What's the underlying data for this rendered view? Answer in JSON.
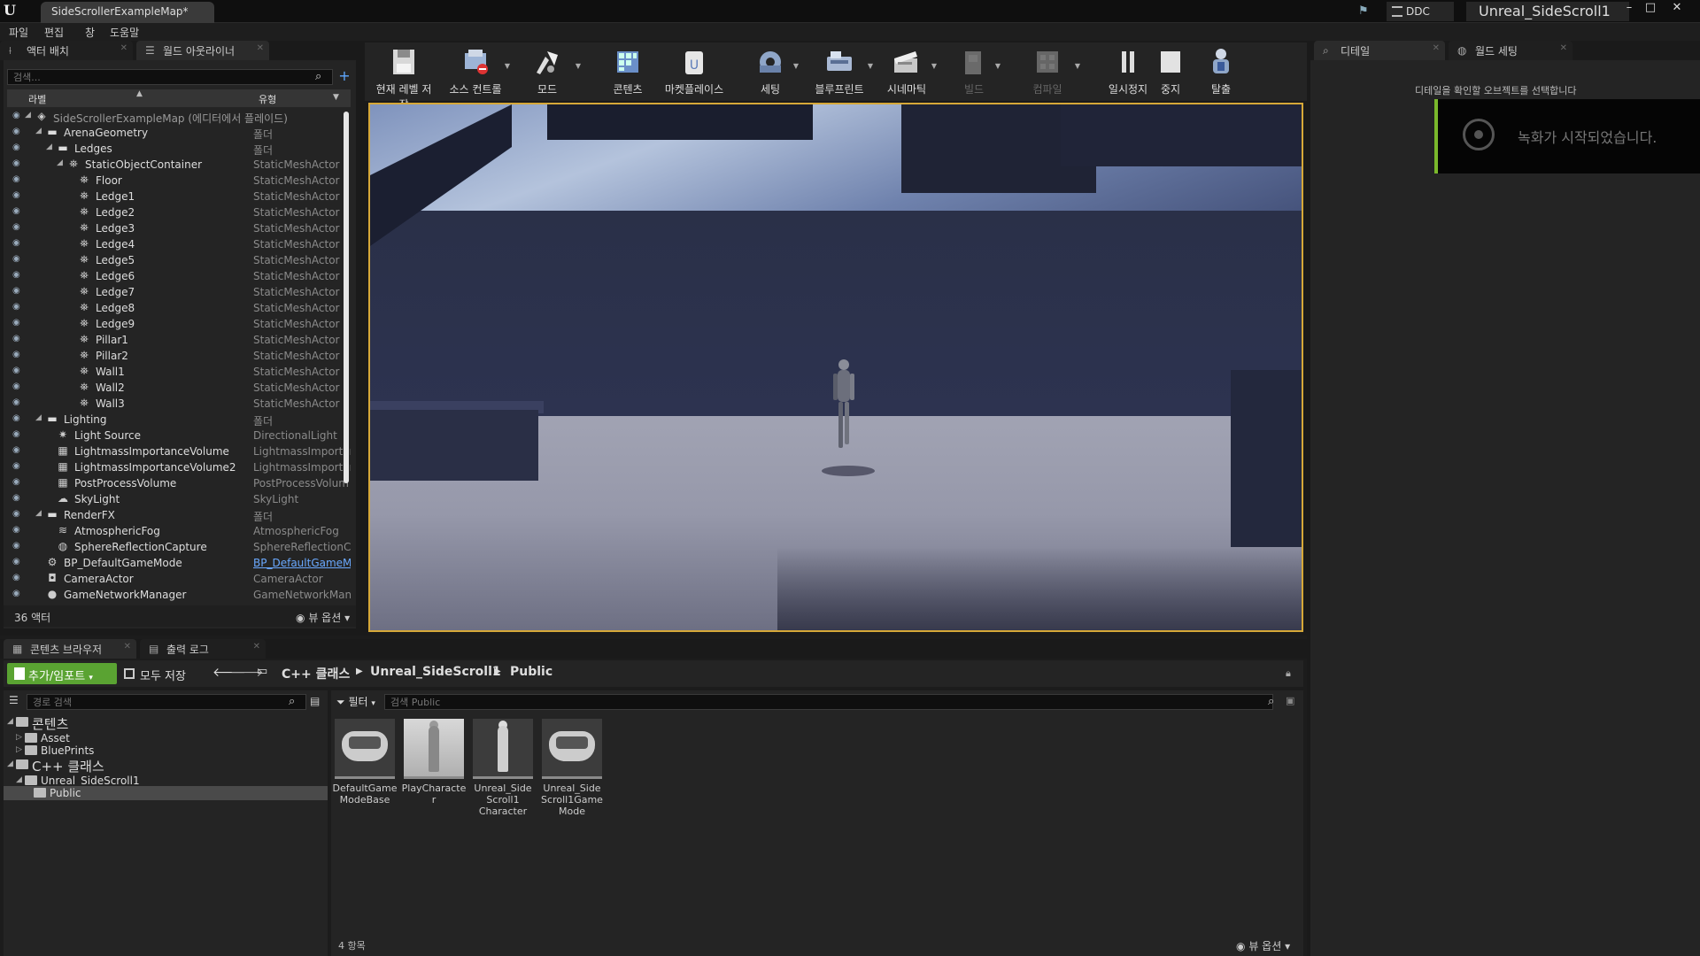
{
  "titlebar": {
    "tab_title": "SideScrollerExampleMap*",
    "ddc": "DDC",
    "project": "Unreal_SideScroll1",
    "minimize": "–",
    "restore": "□",
    "close": "✕"
  },
  "menu": [
    "파일",
    "편집",
    "창",
    "도움말"
  ],
  "left_tabs": {
    "place_actors": "액터 배치",
    "world_outliner": "월드 아웃라이너"
  },
  "outliner": {
    "search_placeholder": "검색...",
    "col_label": "라벨",
    "col_type": "유형",
    "actor_count": "36 액터",
    "view_options": "뷰 옵션",
    "rows": [
      {
        "label": "SideScrollerExampleMap (에디터에서 플레이드)",
        "type": "",
        "indent": 0,
        "icon": "world",
        "arrow": "open",
        "dim": true
      },
      {
        "label": "ArenaGeometry",
        "type": "폴더",
        "indent": 1,
        "icon": "folder",
        "arrow": "open"
      },
      {
        "label": "Ledges",
        "type": "폴더",
        "indent": 2,
        "icon": "folder",
        "arrow": "open"
      },
      {
        "label": "StaticObjectContainer",
        "type": "StaticMeshActor",
        "indent": 3,
        "icon": "actor",
        "arrow": "open"
      },
      {
        "label": "Floor",
        "type": "StaticMeshActor",
        "indent": 4,
        "icon": "actor"
      },
      {
        "label": "Ledge1",
        "type": "StaticMeshActor",
        "indent": 4,
        "icon": "actor"
      },
      {
        "label": "Ledge2",
        "type": "StaticMeshActor",
        "indent": 4,
        "icon": "actor"
      },
      {
        "label": "Ledge3",
        "type": "StaticMeshActor",
        "indent": 4,
        "icon": "actor"
      },
      {
        "label": "Ledge4",
        "type": "StaticMeshActor",
        "indent": 4,
        "icon": "actor"
      },
      {
        "label": "Ledge5",
        "type": "StaticMeshActor",
        "indent": 4,
        "icon": "actor"
      },
      {
        "label": "Ledge6",
        "type": "StaticMeshActor",
        "indent": 4,
        "icon": "actor"
      },
      {
        "label": "Ledge7",
        "type": "StaticMeshActor",
        "indent": 4,
        "icon": "actor"
      },
      {
        "label": "Ledge8",
        "type": "StaticMeshActor",
        "indent": 4,
        "icon": "actor"
      },
      {
        "label": "Ledge9",
        "type": "StaticMeshActor",
        "indent": 4,
        "icon": "actor"
      },
      {
        "label": "Pillar1",
        "type": "StaticMeshActor",
        "indent": 4,
        "icon": "actor"
      },
      {
        "label": "Pillar2",
        "type": "StaticMeshActor",
        "indent": 4,
        "icon": "actor"
      },
      {
        "label": "Wall1",
        "type": "StaticMeshActor",
        "indent": 4,
        "icon": "actor"
      },
      {
        "label": "Wall2",
        "type": "StaticMeshActor",
        "indent": 4,
        "icon": "actor"
      },
      {
        "label": "Wall3",
        "type": "StaticMeshActor",
        "indent": 4,
        "icon": "actor"
      },
      {
        "label": "Lighting",
        "type": "폴더",
        "indent": 1,
        "icon": "folder",
        "arrow": "open"
      },
      {
        "label": "Light Source",
        "type": "DirectionalLight",
        "indent": 2,
        "icon": "light"
      },
      {
        "label": "LightmassImportanceVolume",
        "type": "LightmassImportar",
        "indent": 2,
        "icon": "volume"
      },
      {
        "label": "LightmassImportanceVolume2",
        "type": "LightmassImportar",
        "indent": 2,
        "icon": "volume"
      },
      {
        "label": "PostProcessVolume",
        "type": "PostProcessVolum",
        "indent": 2,
        "icon": "volume"
      },
      {
        "label": "SkyLight",
        "type": "SkyLight",
        "indent": 2,
        "icon": "sky"
      },
      {
        "label": "RenderFX",
        "type": "폴더",
        "indent": 1,
        "icon": "folder",
        "arrow": "open"
      },
      {
        "label": "AtmosphericFog",
        "type": "AtmosphericFog",
        "indent": 2,
        "icon": "fog"
      },
      {
        "label": "SphereReflectionCapture",
        "type": "SphereReflectionCa",
        "indent": 2,
        "icon": "sphere"
      },
      {
        "label": "BP_DefaultGameMode",
        "type": "BP_DefaultGameM",
        "indent": 1,
        "icon": "gamemode",
        "link": true
      },
      {
        "label": "CameraActor",
        "type": "CameraActor",
        "indent": 1,
        "icon": "camera"
      },
      {
        "label": "GameNetworkManager",
        "type": "GameNetworkMana",
        "indent": 1,
        "icon": "network"
      }
    ]
  },
  "toolbar": [
    {
      "id": "save-current-level",
      "label": "현재 레벨 저장",
      "icon": "save-icon",
      "dropdown": false,
      "enabled": true
    },
    {
      "id": "source-control",
      "label": "소스 컨트롤",
      "icon": "source-control-icon",
      "dropdown": true,
      "enabled": true
    },
    {
      "id": "modes",
      "label": "모드",
      "icon": "modes-icon",
      "dropdown": true,
      "enabled": true
    },
    {
      "id": "content",
      "label": "콘텐츠",
      "icon": "content-icon",
      "dropdown": false,
      "enabled": true
    },
    {
      "id": "marketplace",
      "label": "마켓플레이스",
      "icon": "marketplace-icon",
      "dropdown": false,
      "enabled": true
    },
    {
      "id": "settings",
      "label": "세팅",
      "icon": "settings-icon",
      "dropdown": true,
      "enabled": true
    },
    {
      "id": "blueprints",
      "label": "블루프린트",
      "icon": "blueprint-icon",
      "dropdown": true,
      "enabled": true
    },
    {
      "id": "cinematics",
      "label": "시네마틱",
      "icon": "cinematics-icon",
      "dropdown": true,
      "enabled": true
    },
    {
      "id": "build",
      "label": "빌드",
      "icon": "build-icon",
      "dropdown": true,
      "enabled": false
    },
    {
      "id": "compile",
      "label": "컴파일",
      "icon": "compile-icon",
      "dropdown": true,
      "enabled": false
    },
    {
      "id": "pause",
      "label": "일시정지",
      "icon": "pause-icon",
      "dropdown": false,
      "enabled": true
    },
    {
      "id": "stop",
      "label": "중지",
      "icon": "stop-icon",
      "dropdown": false,
      "enabled": true
    },
    {
      "id": "eject",
      "label": "탈출",
      "icon": "eject-icon",
      "dropdown": false,
      "enabled": true
    }
  ],
  "right_tabs": {
    "details": "디테일",
    "world_settings": "월드 세팅"
  },
  "details": {
    "message": "디테일을 확인할 오브젝트를 선택합니다"
  },
  "toast": {
    "text": "녹화가 시작되었습니다."
  },
  "bottom_tabs": {
    "content_browser": "콘텐츠 브라우저",
    "output_log": "출력 로그"
  },
  "content_browser": {
    "add_import": "추가/임포트",
    "save_all": "모두 저장",
    "breadcrumb": [
      "C++ 클래스",
      "Unreal_SideScroll1",
      "Public"
    ],
    "path_search_placeholder": "경로 검색",
    "filter": "필터",
    "asset_search_placeholder": "검색 Public",
    "tree": [
      {
        "label": "콘텐츠",
        "indent": 0,
        "big": true,
        "arrow": "open"
      },
      {
        "label": "Asset",
        "indent": 1,
        "arrow": "closed"
      },
      {
        "label": "BluePrints",
        "indent": 1,
        "arrow": "closed"
      },
      {
        "label": "C++ 클래스",
        "indent": 0,
        "big": true,
        "arrow": "open"
      },
      {
        "label": "Unreal_SideScroll1",
        "indent": 1,
        "arrow": "open"
      },
      {
        "label": "Public",
        "indent": 2,
        "selected": true
      }
    ],
    "assets": [
      {
        "name": "DefaultGame ModeBase",
        "thumb": "gamepad"
      },
      {
        "name": "PlayCharacter",
        "thumb": "character-light"
      },
      {
        "name": "Unreal_Side Scroll1 Character",
        "thumb": "character"
      },
      {
        "name": "Unreal_Side Scroll1Game Mode",
        "thumb": "gamepad"
      }
    ],
    "item_count": "4 항목",
    "view_options": "뷰 옵션"
  },
  "colors": {
    "accent_green": "#5aa332",
    "viewport_border": "#d6a838",
    "link_blue": "#6aa9ff"
  }
}
